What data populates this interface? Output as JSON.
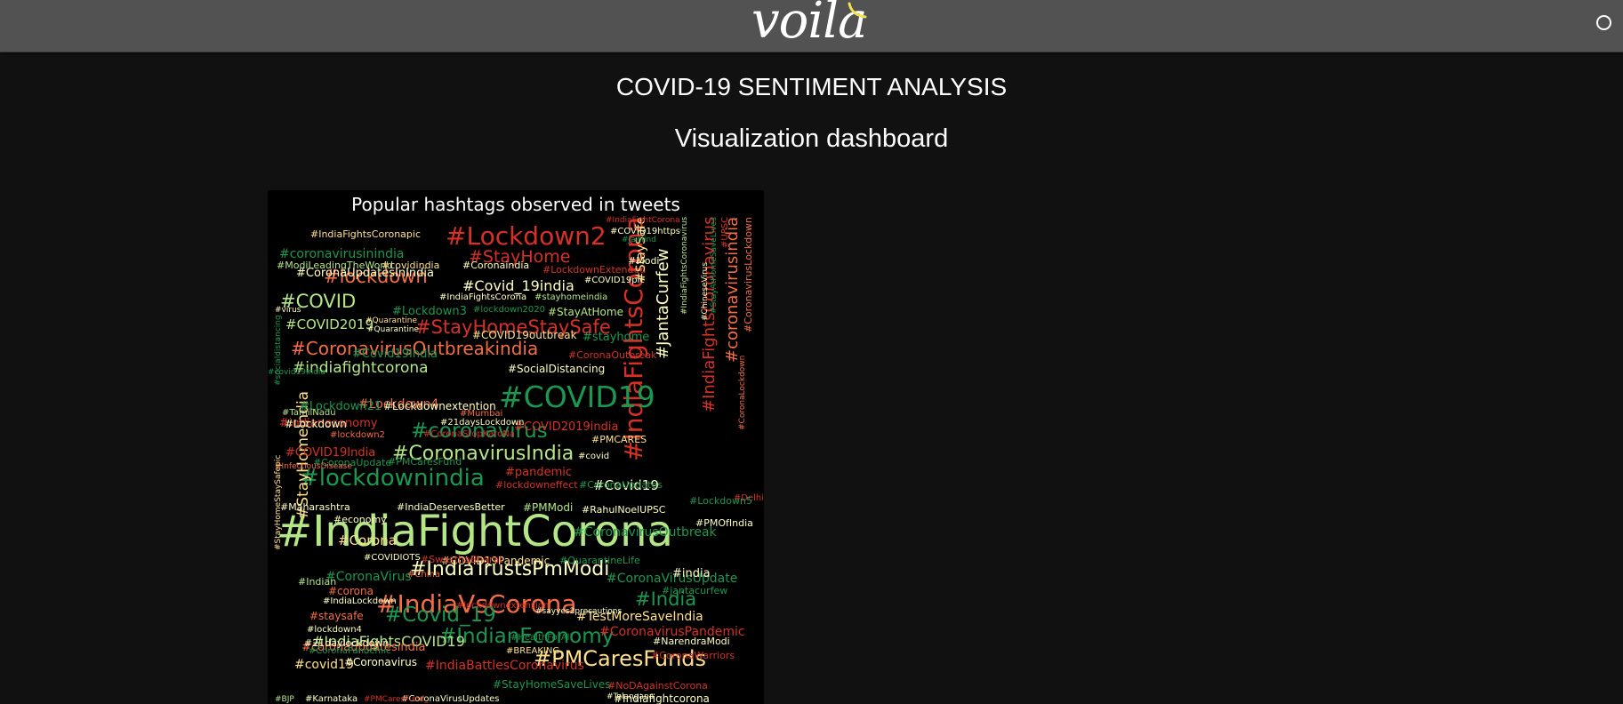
{
  "topbar": {
    "logo_text": "voila",
    "logo_arc_color": "#f5e14b",
    "kernel_status_icon": "circle-icon"
  },
  "main": {
    "heading": "COVID-19 SENTIMENT ANALYSIS",
    "subheading": "Visualization dashboard"
  },
  "wordcloud": {
    "title": "Popular hashtags observed in tweets",
    "palette": [
      "#b5e685",
      "#ffffbf",
      "#d73027",
      "#1a9850",
      "#f46d43",
      "#fee08b"
    ],
    "words": [
      {
        "text": "#IndiaFightCorona",
        "color": "#b5e685"
      },
      {
        "text": "#IndiaFightsCorona",
        "color": "#d73027"
      },
      {
        "text": "#COVID19",
        "color": "#1a9850"
      },
      {
        "text": "#Lockdown2",
        "color": "#d73027"
      },
      {
        "text": "#IndiaVsCorona",
        "color": "#f46d43"
      },
      {
        "text": "#lockdownindia",
        "color": "#1a9850"
      },
      {
        "text": "#CoronavirusIndia",
        "color": "#b5e685"
      },
      {
        "text": "#coronavirus",
        "color": "#1a9850"
      },
      {
        "text": "#PMCaresFunds",
        "color": "#fee08b"
      },
      {
        "text": "#IndianEconomy",
        "color": "#1a9850"
      },
      {
        "text": "#IndiaTrustsPmModi",
        "color": "#ffffbf"
      },
      {
        "text": "#Covid_19",
        "color": "#1a9850"
      },
      {
        "text": "#StayHomeStaySafe",
        "color": "#d73027"
      },
      {
        "text": "#CoronavirusOutbreakindia",
        "color": "#f46d43"
      },
      {
        "text": "#lockdown",
        "color": "#f46d43"
      },
      {
        "text": "#StayHome",
        "color": "#d73027"
      },
      {
        "text": "#COVID",
        "color": "#b5e685"
      },
      {
        "text": "#indiafightcorona",
        "color": "#b5e685"
      },
      {
        "text": "#JantaCurfew",
        "color": "#ffffbf"
      },
      {
        "text": "#IndiaFightsCoronavirus",
        "color": "#d73027"
      },
      {
        "text": "#coronavirusindia",
        "color": "#f46d43"
      },
      {
        "text": "#India",
        "color": "#1a9850"
      },
      {
        "text": "#StayHomeIndia",
        "color": "#fee08b"
      },
      {
        "text": "#Covid_19india",
        "color": "#ffffbf"
      },
      {
        "text": "#COVID2019",
        "color": "#b5e685"
      },
      {
        "text": "#Covid19India",
        "color": "#1a9850"
      },
      {
        "text": "#Lockdown4",
        "color": "#f46d43"
      },
      {
        "text": "#CoronaVirusUpdate",
        "color": "#1a9850"
      },
      {
        "text": "#CoronavirusOutbreak",
        "color": "#1a9850"
      },
      {
        "text": "#TestMoreSaveIndia",
        "color": "#fee08b"
      },
      {
        "text": "#IndiaFightsCOVID19",
        "color": "#b5e685"
      },
      {
        "text": "#Corona",
        "color": "#fee08b"
      },
      {
        "text": "#Covid19",
        "color": "#ffffbf"
      },
      {
        "text": "#coronavirusinindia",
        "color": "#1a9850"
      },
      {
        "text": "#CoronaUpdatesInIndia",
        "color": "#ffffbf"
      },
      {
        "text": "#indianeconomy",
        "color": "#d73027"
      },
      {
        "text": "#COVID19India",
        "color": "#d73027"
      },
      {
        "text": "#pandemic",
        "color": "#d73027"
      },
      {
        "text": "#CoronaVirus",
        "color": "#1a9850"
      },
      {
        "text": "#covid19",
        "color": "#fee08b"
      },
      {
        "text": "#IndiaBattlesCoronavirus",
        "color": "#d73027"
      },
      {
        "text": "#coronaupdatesindia",
        "color": "#f46d43"
      },
      {
        "text": "#CoronavirusPandemic",
        "color": "#d73027"
      },
      {
        "text": "#Lockdown21",
        "color": "#1a9850"
      },
      {
        "text": "#Lockdownextention",
        "color": "#ffffbf"
      },
      {
        "text": "#SocialDistancing",
        "color": "#ffffbf"
      },
      {
        "text": "#stayhome",
        "color": "#1a9850"
      },
      {
        "text": "#COVID2019india",
        "color": "#d73027"
      },
      {
        "text": "#COVID19Pandemic",
        "color": "#fee08b"
      },
      {
        "text": "#IndiaFightsCoronapic",
        "color": "#fee08b"
      },
      {
        "text": "#ModiLeadingTheWorld",
        "color": "#b5e685"
      },
      {
        "text": "#covidindia",
        "color": "#fee08b"
      },
      {
        "text": "#Coronaindia",
        "color": "#ffffbf"
      },
      {
        "text": "#LockdownExtended",
        "color": "#d73027"
      },
      {
        "text": "#IndiaFightsCorona",
        "color": "#ffffbf"
      },
      {
        "text": "#stayhomeindia",
        "color": "#b5e685"
      },
      {
        "text": "#StayAtHome",
        "color": "#b5e685"
      },
      {
        "text": "#StaySafe",
        "color": "#fee08b"
      },
      {
        "text": "#Lockdown3",
        "color": "#1a9850"
      },
      {
        "text": "#lockdown2020",
        "color": "#1a9850"
      },
      {
        "text": "#Quarantine",
        "color": "#ffffbf"
      },
      {
        "text": "#COVID19outbreak",
        "color": "#fee08b"
      },
      {
        "text": "#CoronaOutbreak",
        "color": "#d73027"
      },
      {
        "text": "#virus",
        "color": "#ffffbf"
      },
      {
        "text": "#Modi",
        "color": "#ffffbf"
      },
      {
        "text": "#Lockdown",
        "color": "#ffffbf"
      },
      {
        "text": "#21daysLockdown",
        "color": "#ffffbf"
      },
      {
        "text": "#PMCARES",
        "color": "#fee08b"
      },
      {
        "text": "#TamilNadu",
        "color": "#b5e685"
      },
      {
        "text": "#Mumbai",
        "color": "#f46d43"
      },
      {
        "text": "#lockdown2",
        "color": "#f46d43"
      },
      {
        "text": "#CoronaStopKaroNa",
        "color": "#d73027"
      },
      {
        "text": "#CoronaUpdate",
        "color": "#1a9850"
      },
      {
        "text": "#PMCaresFund",
        "color": "#1a9850"
      },
      {
        "text": "#covid",
        "color": "#ffffbf"
      },
      {
        "text": "#InfectiousDisease",
        "color": "#f46d43"
      },
      {
        "text": "#lockdowneffect",
        "color": "#d73027"
      },
      {
        "text": "#CoronaUpdates",
        "color": "#1a9850"
      },
      {
        "text": "#IndiaDeservesBetter",
        "color": "#ffffbf"
      },
      {
        "text": "#Maharashtra",
        "color": "#ffffbf"
      },
      {
        "text": "#PMModi",
        "color": "#b5e685"
      },
      {
        "text": "#RahulNoelUPSC",
        "color": "#ffffbf"
      },
      {
        "text": "#economy",
        "color": "#ffffbf"
      },
      {
        "text": "#PMOfIndia",
        "color": "#ffffbf"
      },
      {
        "text": "#Delhi",
        "color": "#d73027"
      },
      {
        "text": "#Lockdown5",
        "color": "#1a9850"
      },
      {
        "text": "#COVIDIOTS",
        "color": "#ffffbf"
      },
      {
        "text": "#SwasthaBharat",
        "color": "#d73027"
      },
      {
        "text": "#QuarantineLife",
        "color": "#1a9850"
      },
      {
        "text": "#india",
        "color": "#ffffbf"
      },
      {
        "text": "#China",
        "color": "#f46d43"
      },
      {
        "text": "#Indian",
        "color": "#b5e685"
      },
      {
        "text": "#corona",
        "color": "#f46d43"
      },
      {
        "text": "#IndiaLockdown",
        "color": "#ffffbf"
      },
      {
        "text": "#jantacurfew",
        "color": "#1a9850"
      },
      {
        "text": "#lockdownextension",
        "color": "#d73027"
      },
      {
        "text": "#sayyes2precautions",
        "color": "#ffffbf"
      },
      {
        "text": "#staysafe",
        "color": "#f46d43"
      },
      {
        "text": "#lockdown4",
        "color": "#ffffbf"
      },
      {
        "text": "#21daylockdown",
        "color": "#ffffbf"
      },
      {
        "text": "#HealthForAll",
        "color": "#1a9850"
      },
      {
        "text": "#BREAKING",
        "color": "#fee08b"
      },
      {
        "text": "#CoronaPandemic",
        "color": "#1a9850"
      },
      {
        "text": "#Coronavirus",
        "color": "#ffffbf"
      },
      {
        "text": "#NarendraModi",
        "color": "#ffffbf"
      },
      {
        "text": "#CoronaWarriors",
        "color": "#d73027"
      },
      {
        "text": "#StayHomeSaveLives",
        "color": "#1a9850"
      },
      {
        "text": "#NoDAgainstCorona",
        "color": "#d73027"
      },
      {
        "text": "#Telangana",
        "color": "#ffffbf"
      },
      {
        "text": "#Karnataka",
        "color": "#ffffbf"
      },
      {
        "text": "#CoronaVirusUpdates",
        "color": "#ffffbf"
      },
      {
        "text": "#Indiafightcorona",
        "color": "#ffffbf"
      },
      {
        "text": "#StayHomeStaySafepic",
        "color": "#fee08b"
      },
      {
        "text": "#socialdistancing",
        "color": "#1a9850"
      },
      {
        "text": "#CoronaLockdown",
        "color": "#f46d43"
      },
      {
        "text": "#CoronavirusLockdown",
        "color": "#f46d43"
      },
      {
        "text": "#StayAtHomeSaveLives",
        "color": "#1a9850"
      },
      {
        "text": "#ChineseVirus",
        "color": "#ffffbf"
      },
      {
        "text": "#UPSC",
        "color": "#d73027"
      },
      {
        "text": "#Quarantine",
        "color": "#fee08b"
      },
      {
        "text": "#COVID19https",
        "color": "#ffffbf"
      },
      {
        "text": "#JaiHind",
        "color": "#1a9850"
      },
      {
        "text": "#COVID19pic",
        "color": "#ffffbf"
      },
      {
        "text": "#IndiaFightsCoronavirus",
        "color": "#b5e685"
      },
      {
        "text": "#covid19india",
        "color": "#1a9850"
      },
      {
        "text": "#IndiaFightCorona",
        "color": "#d73027"
      },
      {
        "text": "#BJP",
        "color": "#b5e685"
      },
      {
        "text": "#PMCaresFund_",
        "color": "#d73027"
      }
    ]
  }
}
